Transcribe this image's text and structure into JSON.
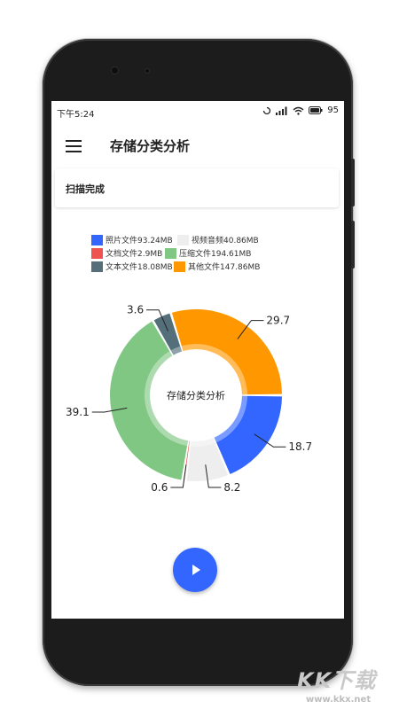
{
  "status": {
    "time": "下午5:24",
    "battery": "95"
  },
  "appbar": {
    "title": "存储分类分析"
  },
  "scan": {
    "text": "扫描完成"
  },
  "legend": [
    {
      "label": "照片文件93.24MB",
      "color": "#3366ff"
    },
    {
      "label": "视频音频40.86MB",
      "color": "#eeeeee"
    },
    {
      "label": "文档文件2.9MB",
      "color": "#ef5350"
    },
    {
      "label": "压缩文件194.61MB",
      "color": "#81c784"
    },
    {
      "label": "文本文件18.08MB",
      "color": "#546e7a"
    },
    {
      "label": "其他文件147.86MB",
      "color": "#ff9800"
    }
  ],
  "chart_data": {
    "type": "pie",
    "center_label": "存储分类分析",
    "slices": [
      {
        "label": "照片文件93.24MB",
        "value": 18.7,
        "display": "18.7",
        "color": "#3366ff"
      },
      {
        "label": "视频音频40.86MB",
        "value": 8.2,
        "display": "8.2",
        "color": "#eeeeee"
      },
      {
        "label": "文档文件2.9MB",
        "value": 0.6,
        "display": "0.6",
        "color": "#ef5350"
      },
      {
        "label": "压缩文件194.61MB",
        "value": 39.1,
        "display": "39.1",
        "color": "#81c784"
      },
      {
        "label": "文本文件18.08MB",
        "value": 3.6,
        "display": "3.6",
        "color": "#546e7a"
      },
      {
        "label": "其他文件147.86MB",
        "value": 29.7,
        "display": "29.7",
        "color": "#ff9800"
      }
    ]
  },
  "watermark": {
    "logo": "KK下载",
    "url": "www.kkx.net"
  }
}
